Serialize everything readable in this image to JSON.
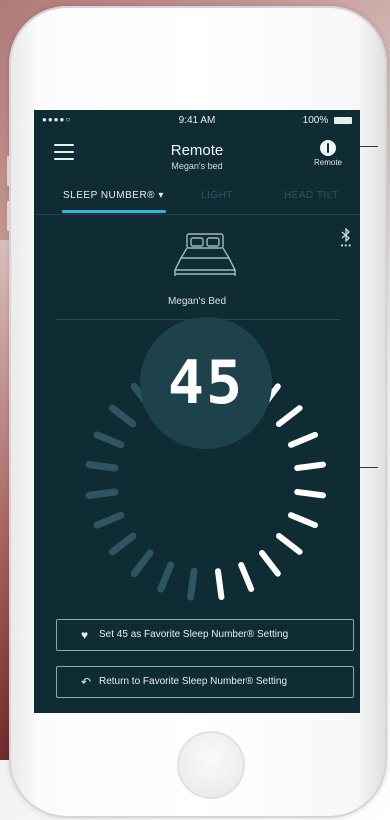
{
  "status_bar": {
    "carrier": "●●●●○",
    "wifi": "wifi-icon",
    "time": "9:41 AM",
    "battery": "100%"
  },
  "header": {
    "title": "Remote",
    "subtitle": "Megan's bed",
    "remote_label": "Remote"
  },
  "tabs": [
    {
      "label": "SLEEP NUMBER® ▾",
      "active": true
    },
    {
      "label": "LIGHT",
      "active": false
    },
    {
      "label": "HEAD TILT",
      "active": false
    }
  ],
  "bed": {
    "name": "Megan's Bed"
  },
  "bluetooth": {
    "icon": "bluetooth-icon",
    "dots": "•••"
  },
  "dial": {
    "value": "45",
    "level": 45,
    "max": 100,
    "active_color": "#ffffff",
    "inactive_color": "#2e5662"
  },
  "buttons": {
    "favorite_set": "Set 45 as Favorite Sleep Number® Setting",
    "favorite_return": "Return to Favorite Sleep Number® Setting",
    "favorite_icon": "heart-icon",
    "return_icon": "undo-icon"
  },
  "colors": {
    "screen_bg": "#0f2c35",
    "accent": "#2fb5d6"
  }
}
